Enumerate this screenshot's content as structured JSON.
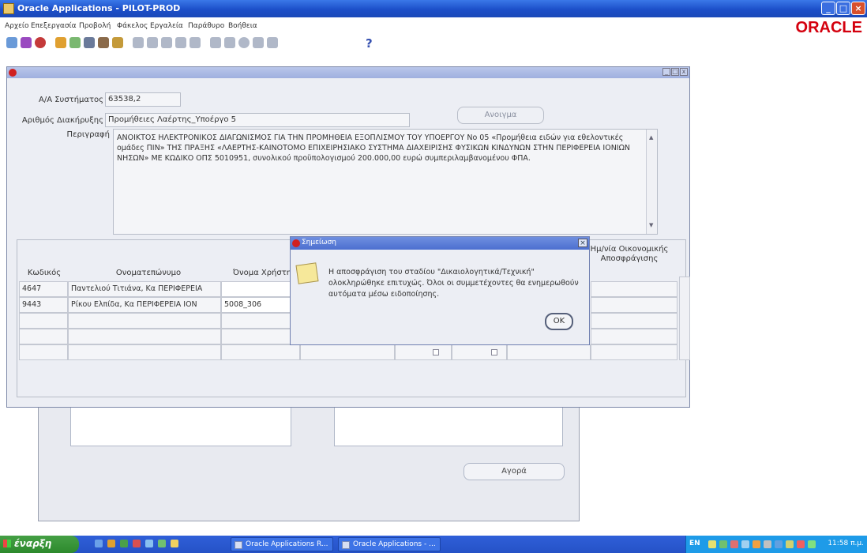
{
  "window": {
    "title": "Oracle Applications - PILOT-PROD"
  },
  "menu": [
    "Αρχείο",
    "Επεξεργασία",
    "Προβολή",
    "Φάκελος",
    "Εργαλεία",
    "Παράθυρο",
    "Βοήθεια"
  ],
  "brand": {
    "logo": "ORACLE",
    "color": "#d4000e"
  },
  "toolbar": {
    "help_glyph": "?"
  },
  "form": {
    "labels": {
      "aa": "Α/Α Συστήματος",
      "arithmos": "Αριθμός Διακήρυξης",
      "perigrafi": "Περιγραφή"
    },
    "aa_value": "63538,2",
    "arithmos_value": "Προμήθειες Λαέρτης_Υποέργο 5",
    "anoigma_button": "Ανοιγμα",
    "description": "ΑΝΟΙΚΤΟΣ ΗΛΕΚΤΡΟΝΙΚΟΣ ΔΙΑΓΩΝΙΣΜΟΣ ΓΙΑ ΤΗΝ ΠΡΟΜΗΘΕΙΑ ΕΞΟΠΛΙΣΜΟΥ ΤΟΥ ΥΠΟΕΡΓΟΥ Νο 05 «Προμήθεια ειδών για εθελοντικές ομάδες ΠΙΝ» ΤΗΣ ΠΡΑΞΗΣ «ΛΑΕΡΤΗΣ-ΚΑΙΝΟΤΟΜΟ ΕΠΙΧΕΙΡΗΣΙΑΚΟ ΣΥΣΤΗΜΑ ΔΙΑΧΕΙΡΙΣΗΣ ΦΥΣΙΚΩΝ ΚΙΝΔΥΝΩΝ ΣΤΗΝ ΠΕΡΙΦΕΡΕΙΑ ΙΟΝΙΩΝ ΝΗΣΩΝ» ΜΕ ΚΩΔΙΚΟ ΟΠΣ 5010951, συνολικού προϋπολογισμού 200.000,00 ευρώ συμπεριλαμβανομένου ΦΠΑ."
  },
  "table": {
    "headers": {
      "kodikos": "Κωδικός",
      "onomateponymo": "Ονοματεπώνυμο",
      "onoma_xristi": "Όνομα Χρήστη",
      "imnia": "Ημ/νία Οικονομικής Αποσφράγισης"
    },
    "rows": [
      {
        "kodikos": "4647",
        "onomateponymo": "Παντελιού Τιτιάνα, Κα ΠΕΡΙΦΕΡΕΙΑ",
        "onoma_xristi": ""
      },
      {
        "kodikos": "9443",
        "onomateponymo": "Ρίκου Ελπίδα, Κα ΠΕΡΙΦΕΡΕΙΑ ΙΟΝ",
        "onoma_xristi": "5008_306"
      },
      {
        "kodikos": "",
        "onomateponymo": "",
        "onoma_xristi": ""
      },
      {
        "kodikos": "",
        "onomateponymo": "",
        "onoma_xristi": ""
      },
      {
        "kodikos": "",
        "onomateponymo": "",
        "onoma_xristi": ""
      }
    ]
  },
  "background_window": {
    "agora_button": "Αγορά"
  },
  "dialog": {
    "title": "Σημείωση",
    "message": "Η αποσφράγιση του σταδίου \"Δικαιολογητικά/Τεχνική\" ολοκληρώθηκε επιτυχώς. Όλοι οι συμμετέχοντες θα ενημερωθούν αυτόματα μέσω ειδοποίησης.",
    "ok": "OK"
  },
  "taskbar": {
    "start": "έναρξη",
    "tasks": [
      "Oracle Applications R...",
      "Oracle Applications - ..."
    ],
    "lang": "EN",
    "clock": "11:58 π.μ."
  }
}
